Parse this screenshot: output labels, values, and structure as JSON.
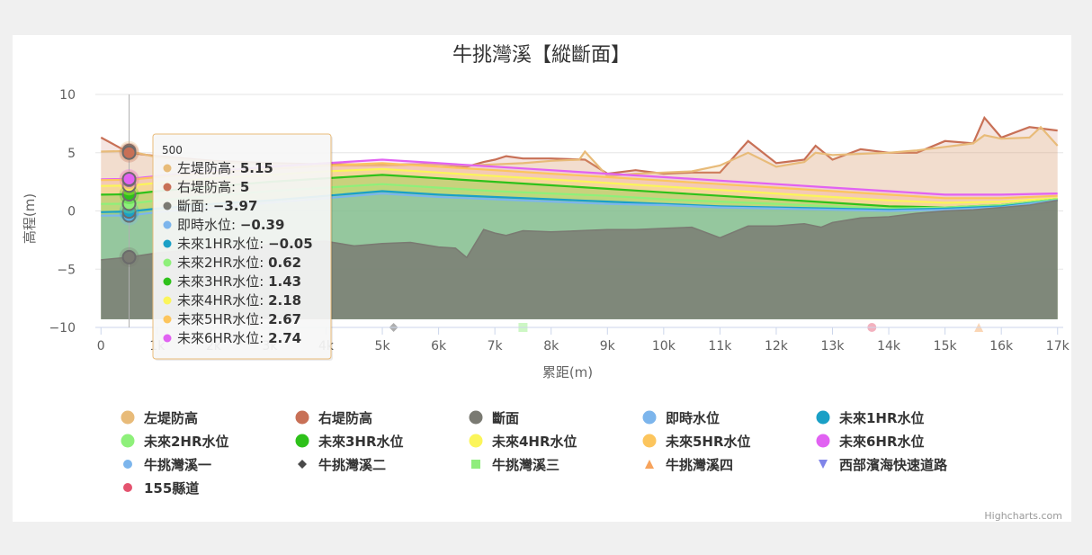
{
  "colors": {
    "left_bank": "#e8bb79",
    "right_bank": "#c87056",
    "section": "#7a7a72",
    "now": "#7cb5ec",
    "f1": "#1aa0c6",
    "f2": "#8ef07a",
    "f3": "#2ec11a",
    "f4": "#fbf55a",
    "f5": "#fcc55d",
    "f6": "#e162f2",
    "p1": "#7cb5ec",
    "p2": "#4a4a4a",
    "p3": "#90ed7d",
    "p4": "#f7a35c",
    "p5": "#8085e9",
    "p6": "#e4536f"
  },
  "chart_data": {
    "type": "area",
    "title": "牛挑灣溪【縱斷面】",
    "xlabel": "累距(m)",
    "ylabel": "高程(m)",
    "xlim": [
      -100,
      17100
    ],
    "ylim": [
      -10,
      10
    ],
    "x_ticks": [
      0,
      1000,
      2000,
      3000,
      4000,
      5000,
      6000,
      7000,
      8000,
      9000,
      10000,
      11000,
      12000,
      13000,
      14000,
      15000,
      16000,
      17000
    ],
    "x_tick_labels": [
      "0",
      "1k",
      "2k",
      "3k",
      "4k",
      "5k",
      "6k",
      "7k",
      "8k",
      "9k",
      "10k",
      "11k",
      "12k",
      "13k",
      "14k",
      "15k",
      "16k",
      "17k"
    ],
    "y_ticks": [
      10,
      5,
      0,
      -5,
      -10
    ],
    "y_tick_labels": [
      "10",
      "5",
      "0",
      "−5",
      "−10"
    ],
    "grid": true,
    "legend_position": "bottom",
    "series": [
      {
        "name": "左堤防高",
        "key": "left_bank",
        "x": [
          0,
          500,
          1000,
          2000,
          3000,
          4000,
          5000,
          6000,
          6500,
          7000,
          7500,
          8000,
          8500,
          8600,
          9000,
          9500,
          10000,
          10500,
          11000,
          11500,
          12000,
          12500,
          12700,
          13000,
          13500,
          14000,
          14500,
          15000,
          15500,
          15700,
          16000,
          16500,
          16700,
          17000
        ],
        "values": [
          5.1,
          5.15,
          4.6,
          4.2,
          4.0,
          3.9,
          3.9,
          4.0,
          3.9,
          4.0,
          4.1,
          4.3,
          4.4,
          5.1,
          3.0,
          3.2,
          3.3,
          3.4,
          3.9,
          5.0,
          3.8,
          4.2,
          5.0,
          4.8,
          4.9,
          5.0,
          5.2,
          5.5,
          5.8,
          6.5,
          6.2,
          6.3,
          7.2,
          5.6
        ]
      },
      {
        "name": "右堤防高",
        "key": "right_bank",
        "x": [
          0,
          500,
          1000,
          2000,
          3000,
          4000,
          5000,
          6000,
          6500,
          6800,
          7000,
          7200,
          7500,
          8000,
          8600,
          9000,
          9500,
          10000,
          10500,
          11000,
          11500,
          12000,
          12500,
          12700,
          13000,
          13500,
          14000,
          14500,
          15000,
          15500,
          15700,
          16000,
          16500,
          17000
        ],
        "values": [
          6.3,
          5.0,
          4.7,
          4.3,
          4.1,
          4.0,
          4.0,
          4.0,
          3.8,
          4.2,
          4.4,
          4.7,
          4.5,
          4.5,
          4.4,
          3.2,
          3.5,
          3.2,
          3.3,
          3.3,
          6.0,
          4.1,
          4.4,
          5.6,
          4.4,
          5.3,
          5.0,
          5.0,
          6.0,
          5.8,
          8.0,
          6.3,
          7.2,
          6.9
        ]
      },
      {
        "name": "斷面",
        "key": "section",
        "x": [
          0,
          500,
          1000,
          1500,
          2000,
          2500,
          3000,
          3500,
          4000,
          4500,
          5000,
          5500,
          6000,
          6300,
          6500,
          6800,
          7000,
          7200,
          7500,
          8000,
          8500,
          9000,
          9500,
          10000,
          10500,
          11000,
          11500,
          12000,
          12500,
          12800,
          13000,
          13500,
          14000,
          14500,
          15000,
          15500,
          16000,
          16500,
          17000
        ],
        "values": [
          -4.2,
          -3.97,
          -3.6,
          -3.4,
          -3.2,
          -3.0,
          -2.9,
          -2.7,
          -2.6,
          -3.0,
          -2.8,
          -2.7,
          -3.1,
          -3.2,
          -4.0,
          -1.6,
          -1.9,
          -2.1,
          -1.7,
          -1.8,
          -1.7,
          -1.6,
          -1.6,
          -1.5,
          -1.4,
          -2.3,
          -1.3,
          -1.3,
          -1.1,
          -1.4,
          -1.0,
          -0.6,
          -0.5,
          -0.2,
          0.0,
          0.1,
          0.3,
          0.5,
          0.9
        ]
      },
      {
        "name": "即時水位",
        "key": "now",
        "x": [
          0,
          500,
          1000,
          2000,
          3000,
          4000,
          5000,
          6000,
          7000,
          8000,
          9000,
          10000,
          11000,
          12000,
          13000,
          14000,
          15000,
          16000,
          17000
        ],
        "values": [
          -0.4,
          -0.39,
          -0.1,
          0.3,
          0.7,
          1.1,
          1.5,
          1.2,
          1.0,
          0.8,
          0.6,
          0.5,
          0.3,
          0.2,
          0.1,
          0.0,
          0.1,
          0.3,
          0.9
        ]
      },
      {
        "name": "未來1HR水位",
        "key": "f1",
        "x": [
          0,
          500,
          1000,
          2000,
          3000,
          4000,
          5000,
          6000,
          7000,
          8000,
          9000,
          10000,
          11000,
          12000,
          13000,
          14000,
          15000,
          16000,
          17000
        ],
        "values": [
          -0.1,
          -0.05,
          0.2,
          0.6,
          0.9,
          1.3,
          1.7,
          1.4,
          1.2,
          1.0,
          0.8,
          0.6,
          0.4,
          0.3,
          0.2,
          0.1,
          0.2,
          0.4,
          0.9
        ]
      },
      {
        "name": "未來2HR水位",
        "key": "f2",
        "x": [
          0,
          500,
          1000,
          2000,
          3000,
          4000,
          5000,
          6000,
          7000,
          8000,
          9000,
          10000,
          11000,
          12000,
          13000,
          14000,
          15000,
          16000,
          17000
        ],
        "values": [
          0.6,
          0.62,
          0.9,
          1.3,
          1.7,
          2.0,
          2.3,
          2.0,
          1.7,
          1.5,
          1.3,
          1.0,
          0.8,
          0.6,
          0.4,
          0.2,
          0.3,
          0.5,
          1.0
        ]
      },
      {
        "name": "未來3HR水位",
        "key": "f3",
        "x": [
          0,
          500,
          1000,
          2000,
          3000,
          4000,
          5000,
          6000,
          7000,
          8000,
          9000,
          10000,
          11000,
          12000,
          13000,
          14000,
          15000,
          16000,
          17000
        ],
        "values": [
          1.4,
          1.43,
          1.7,
          2.1,
          2.5,
          2.8,
          3.1,
          2.8,
          2.5,
          2.2,
          1.9,
          1.6,
          1.3,
          1.0,
          0.7,
          0.4,
          0.3,
          0.5,
          1.0
        ]
      },
      {
        "name": "未來4HR水位",
        "key": "f4",
        "x": [
          0,
          500,
          1000,
          2000,
          3000,
          4000,
          5000,
          6000,
          7000,
          8000,
          9000,
          10000,
          11000,
          12000,
          13000,
          14000,
          15000,
          16000,
          17000
        ],
        "values": [
          2.15,
          2.18,
          2.4,
          2.8,
          3.1,
          3.4,
          3.6,
          3.3,
          3.0,
          2.7,
          2.4,
          2.1,
          1.8,
          1.5,
          1.2,
          0.9,
          0.7,
          0.8,
          1.1
        ]
      },
      {
        "name": "未來5HR水位",
        "key": "f5",
        "x": [
          0,
          500,
          1000,
          2000,
          3000,
          4000,
          5000,
          6000,
          7000,
          8000,
          9000,
          10000,
          11000,
          12000,
          13000,
          14000,
          15000,
          16000,
          17000
        ],
        "values": [
          2.65,
          2.67,
          2.9,
          3.3,
          3.6,
          3.9,
          4.1,
          3.8,
          3.5,
          3.2,
          2.9,
          2.6,
          2.3,
          2.0,
          1.7,
          1.4,
          1.1,
          1.1,
          1.3
        ]
      },
      {
        "name": "未來6HR水位",
        "key": "f6",
        "x": [
          0,
          500,
          1000,
          2000,
          3000,
          4000,
          5000,
          6000,
          7000,
          8000,
          9000,
          10000,
          11000,
          12000,
          13000,
          14000,
          15000,
          16000,
          17000
        ],
        "values": [
          2.72,
          2.74,
          3.0,
          3.4,
          3.8,
          4.1,
          4.4,
          4.1,
          3.8,
          3.5,
          3.2,
          2.9,
          2.6,
          2.3,
          2.0,
          1.7,
          1.4,
          1.4,
          1.5
        ]
      }
    ],
    "point_series": [
      {
        "name": "牛挑灣溪一",
        "key": "p1",
        "symbol": "circle",
        "x": null,
        "y": null
      },
      {
        "name": "牛挑灣溪二",
        "key": "p2",
        "symbol": "diamond",
        "x": 5200,
        "y": -10
      },
      {
        "name": "牛挑灣溪三",
        "key": "p3",
        "symbol": "square",
        "x": 7500,
        "y": -10
      },
      {
        "name": "牛挑灣溪四",
        "key": "p4",
        "symbol": "triangle",
        "x": 15600,
        "y": -10
      },
      {
        "name": "西部濱海快速道路",
        "key": "p5",
        "symbol": "triangle-down",
        "x": null,
        "y": null
      },
      {
        "name": "155縣道",
        "key": "p6",
        "symbol": "circle",
        "x": 13700,
        "y": -10
      }
    ],
    "tooltip": {
      "header": "500",
      "x": 500,
      "rows": [
        {
          "label": "左堤防高",
          "value": "5.15",
          "key": "left_bank"
        },
        {
          "label": "右堤防高",
          "value": "5",
          "key": "right_bank"
        },
        {
          "label": "斷面",
          "value": "−3.97",
          "key": "section"
        },
        {
          "label": "即時水位",
          "value": "−0.39",
          "key": "now"
        },
        {
          "label": "未來1HR水位",
          "value": "−0.05",
          "key": "f1"
        },
        {
          "label": "未來2HR水位",
          "value": "0.62",
          "key": "f2"
        },
        {
          "label": "未來3HR水位",
          "value": "1.43",
          "key": "f3"
        },
        {
          "label": "未來4HR水位",
          "value": "2.18",
          "key": "f4"
        },
        {
          "label": "未來5HR水位",
          "value": "2.67",
          "key": "f5"
        },
        {
          "label": "未來6HR水位",
          "value": "2.74",
          "key": "f6"
        }
      ]
    }
  },
  "credits": "Highcharts.com"
}
